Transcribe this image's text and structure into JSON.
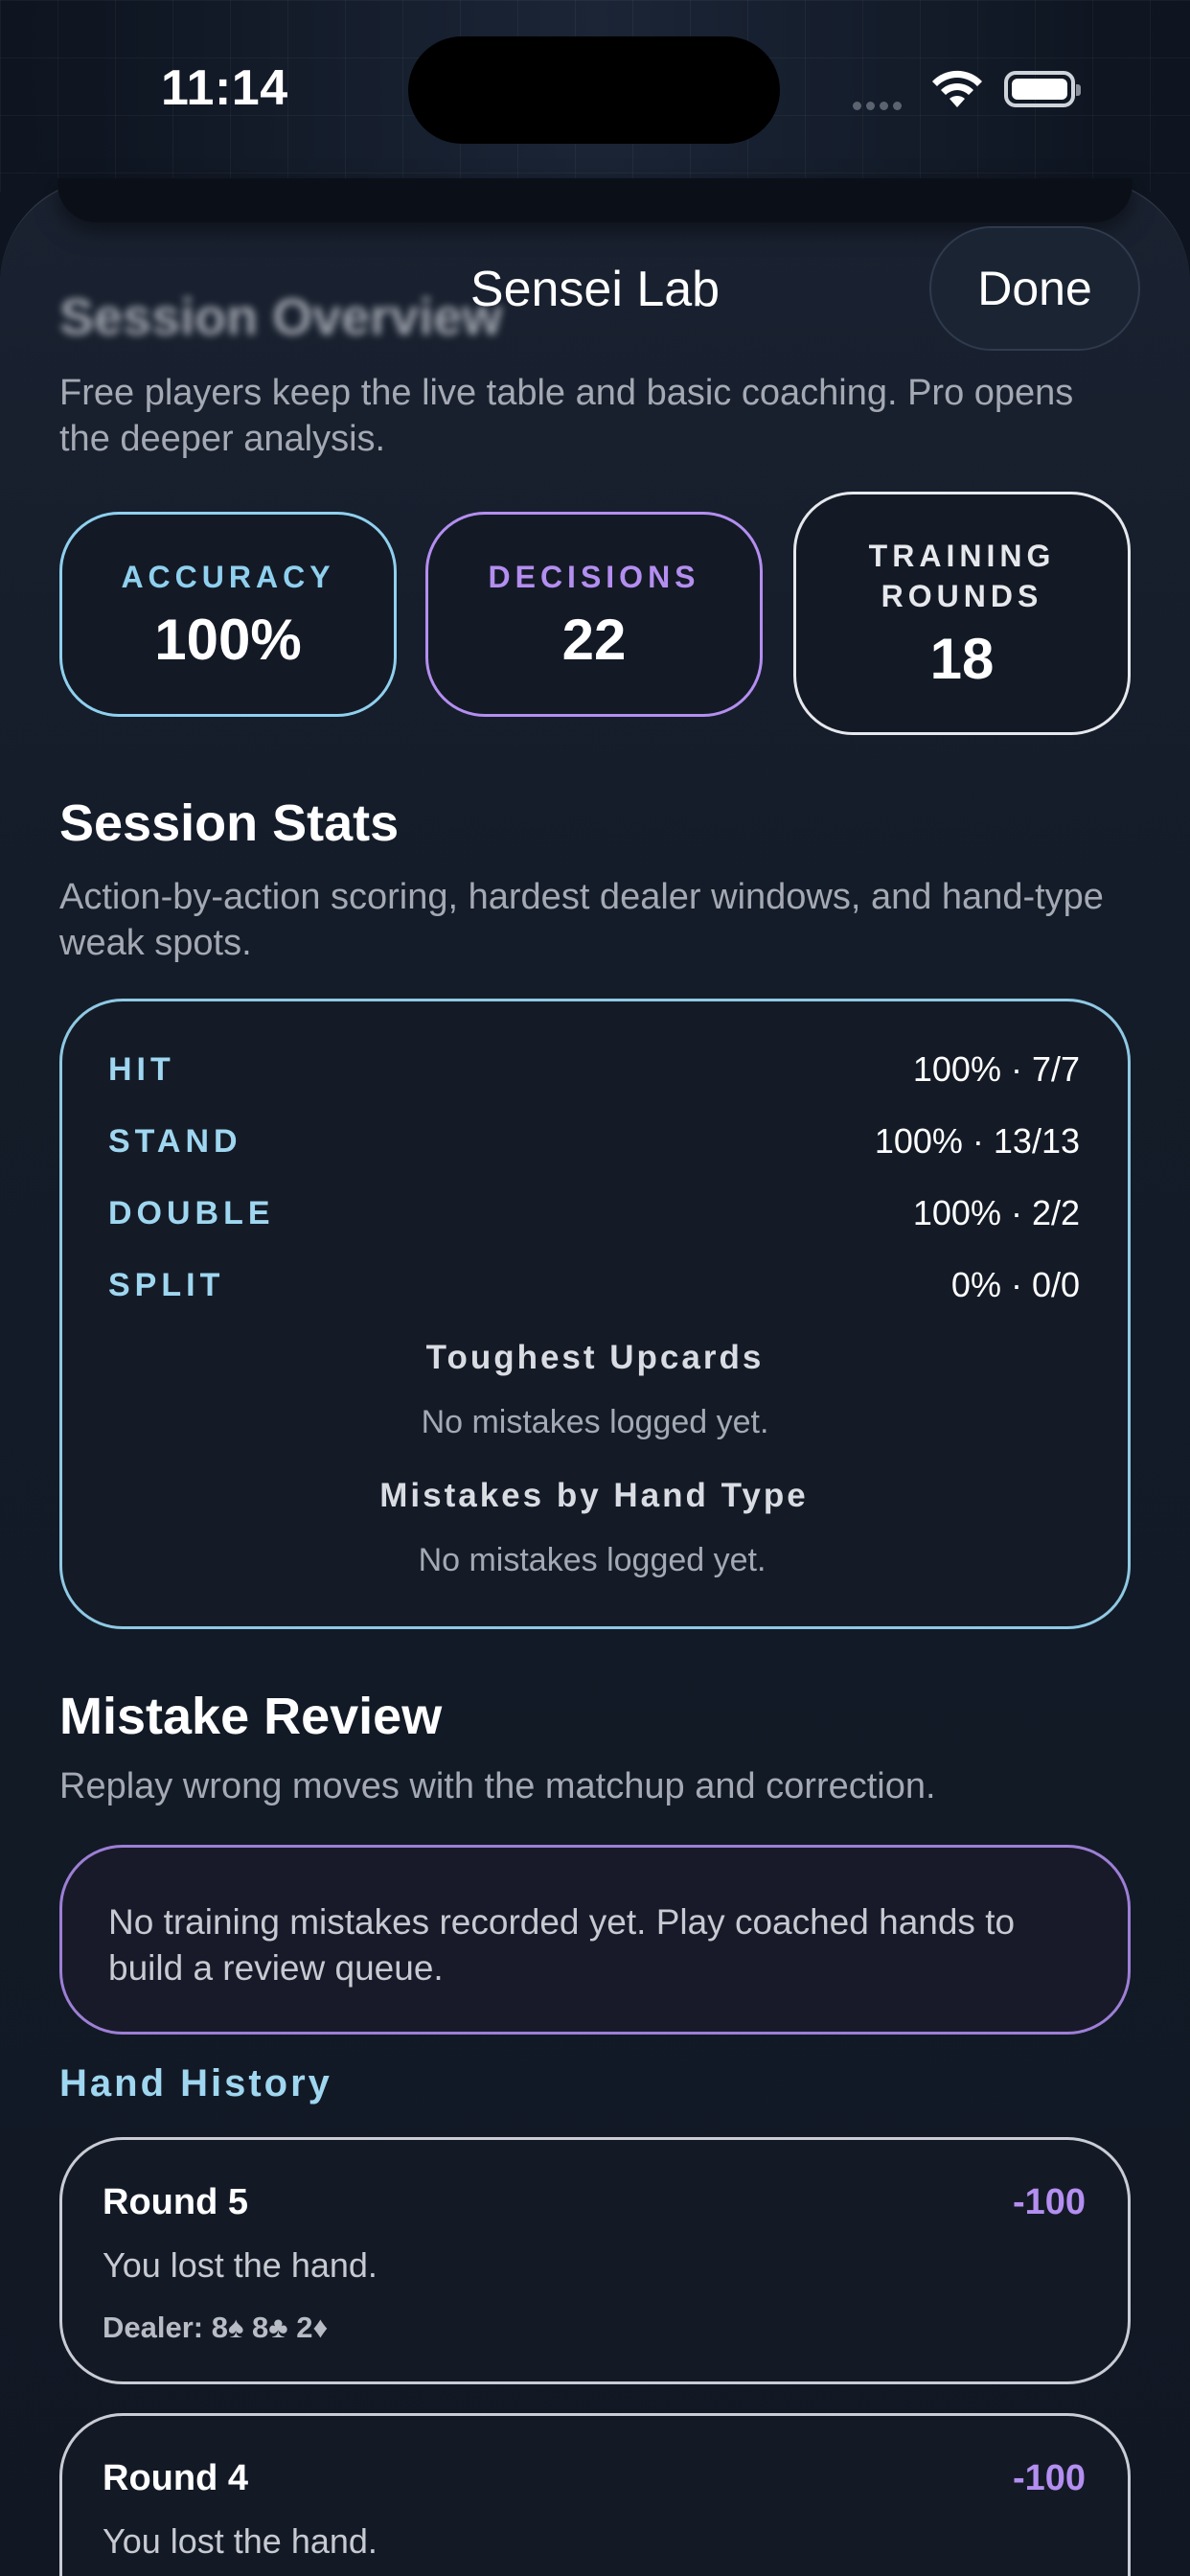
{
  "status_bar": {
    "time": "11:14"
  },
  "nav": {
    "title": "Sensei Lab",
    "done_label": "Done"
  },
  "overview": {
    "title": "Session Overview",
    "subtitle": "Free players keep the live table and basic coaching. Pro opens the deeper analysis."
  },
  "metrics": [
    {
      "label": "ACCURACY",
      "value": "100%",
      "accent": "#8fd0ee"
    },
    {
      "label": "DECISIONS",
      "value": "22",
      "accent": "#b48ef0"
    },
    {
      "label": "TRAINING ROUNDS",
      "value": "18",
      "accent": "#e6e8ec"
    }
  ],
  "session_stats": {
    "title": "Session Stats",
    "subtitle": "Action-by-action scoring, hardest dealer windows, and hand-type weak spots.",
    "rows": [
      {
        "name": "HIT",
        "value": "100% · 7/7"
      },
      {
        "name": "STAND",
        "value": "100% · 13/13"
      },
      {
        "name": "DOUBLE",
        "value": "100% · 2/2"
      },
      {
        "name": "SPLIT",
        "value": "0% · 0/0"
      }
    ],
    "toughest_title": "Toughest Upcards",
    "toughest_text": "No mistakes logged yet.",
    "hand_type_title": "Mistakes by Hand Type",
    "hand_type_text": "No mistakes logged yet."
  },
  "mistake_review": {
    "title": "Mistake Review",
    "subtitle": "Replay wrong moves with the matchup and correction.",
    "empty_text": "No training mistakes recorded yet. Play coached hands to build a review queue."
  },
  "hand_history": {
    "label": "Hand History",
    "rounds": [
      {
        "title": "Round 5",
        "delta": "-100",
        "result": "You lost the hand.",
        "dealer": "Dealer: 8♠  8♣  2♦"
      },
      {
        "title": "Round 4",
        "delta": "-100",
        "result": "You lost the hand.",
        "dealer": ""
      }
    ]
  },
  "colors": {
    "accent_blue": "#8fd0ee",
    "accent_purple": "#b48ef0",
    "background": "#111824"
  }
}
